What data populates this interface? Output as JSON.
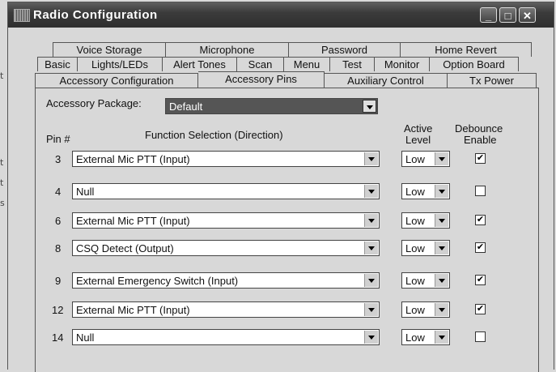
{
  "window": {
    "title": "Radio Configuration"
  },
  "tabs": {
    "row1": [
      "Voice Storage",
      "Microphone",
      "Password",
      "Home Revert"
    ],
    "row2": [
      "Basic",
      "Lights/LEDs",
      "Alert Tones",
      "Scan",
      "Menu",
      "Test",
      "Monitor",
      "Option Board"
    ],
    "row3": [
      "Accessory Configuration",
      "Accessory Pins",
      "Auxiliary Control",
      "Tx Power"
    ],
    "active": "Accessory Pins"
  },
  "accessory": {
    "label": "Accessory Package:",
    "value": "Default"
  },
  "headers": {
    "pin": "Pin #",
    "function": "Function Selection (Direction)",
    "active_level_1": "Active",
    "active_level_2": "Level",
    "debounce_1": "Debounce",
    "debounce_2": "Enable"
  },
  "pins": [
    {
      "pin": "3",
      "function": "External Mic PTT (Input)",
      "level": "Low",
      "debounce": true
    },
    {
      "pin": "4",
      "function": "Null",
      "level": "Low",
      "debounce": false
    },
    {
      "pin": "6",
      "function": "External Mic PTT (Input)",
      "level": "Low",
      "debounce": true
    },
    {
      "pin": "8",
      "function": "CSQ Detect (Output)",
      "level": "Low",
      "debounce": true
    },
    {
      "pin": "9",
      "function": "External Emergency Switch (Input)",
      "level": "Low",
      "debounce": true
    },
    {
      "pin": "12",
      "function": "External Mic PTT (Input)",
      "level": "Low",
      "debounce": true
    },
    {
      "pin": "14",
      "function": "Null",
      "level": "Low",
      "debounce": false
    }
  ],
  "stray_chars": [
    "t",
    "t",
    "t",
    "s"
  ]
}
